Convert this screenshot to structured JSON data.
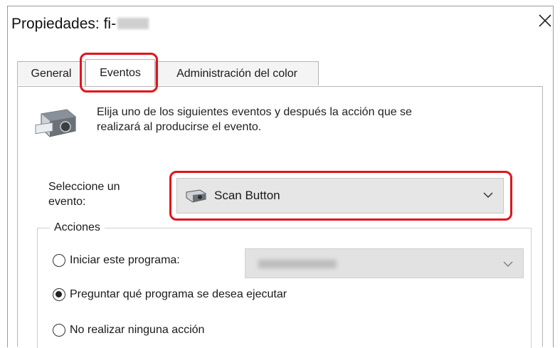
{
  "window": {
    "title": "Propiedades: fi-",
    "close_icon": "close-icon"
  },
  "tabs": [
    {
      "label": "General",
      "selected": false
    },
    {
      "label": "Eventos",
      "selected": true
    },
    {
      "label": "Administración del color",
      "selected": false
    }
  ],
  "panel": {
    "icon": "scanner-icon",
    "description_line1": "Elija uno de los siguientes eventos y después la acción que se",
    "description_line2": "realizará al producirse el evento.",
    "select_label_line1": "Seleccione un",
    "select_label_line2": "evento:",
    "event_combo": {
      "icon": "scanner-small-icon",
      "value": "Scan Button"
    },
    "actions": {
      "group_title": "Acciones",
      "options": [
        {
          "label": "Iniciar este programa:",
          "mnemonic": "I",
          "selected": false
        },
        {
          "label": "Preguntar qué programa se desea ejecutar",
          "mnemonic": "P",
          "selected": true
        },
        {
          "label": "No realizar ninguna acción",
          "mnemonic": "N",
          "selected": false
        }
      ]
    }
  },
  "colors": {
    "highlight": "#e0141c",
    "combo_bg": "#e6e6e6"
  }
}
